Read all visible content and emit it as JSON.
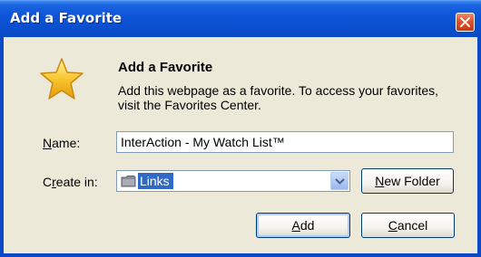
{
  "window": {
    "title": "Add a Favorite"
  },
  "header": {
    "heading": "Add a Favorite",
    "description": "Add this webpage as a favorite. To access your favorites, visit the Favorites Center."
  },
  "form": {
    "name_label": {
      "key": "N",
      "rest": "ame:"
    },
    "name_value": "InterAction - My Watch List™",
    "create_in_label": {
      "pre": "C",
      "key": "r",
      "rest": "eate in:"
    },
    "create_in_value": "Links"
  },
  "buttons": {
    "new_folder": {
      "key": "N",
      "rest": "ew Folder"
    },
    "add": {
      "key": "A",
      "rest": "dd"
    },
    "cancel": {
      "key": "C",
      "rest": "ancel"
    }
  },
  "icons": {
    "star": "star-icon",
    "close": "close-icon",
    "folder": "folder-icon",
    "dropdown": "chevron-down-icon"
  },
  "colors": {
    "titlebar": "#0b4ac4",
    "dialog_bg": "#ece9d8",
    "selection": "#316ac5",
    "close_button": "#e0512e"
  }
}
